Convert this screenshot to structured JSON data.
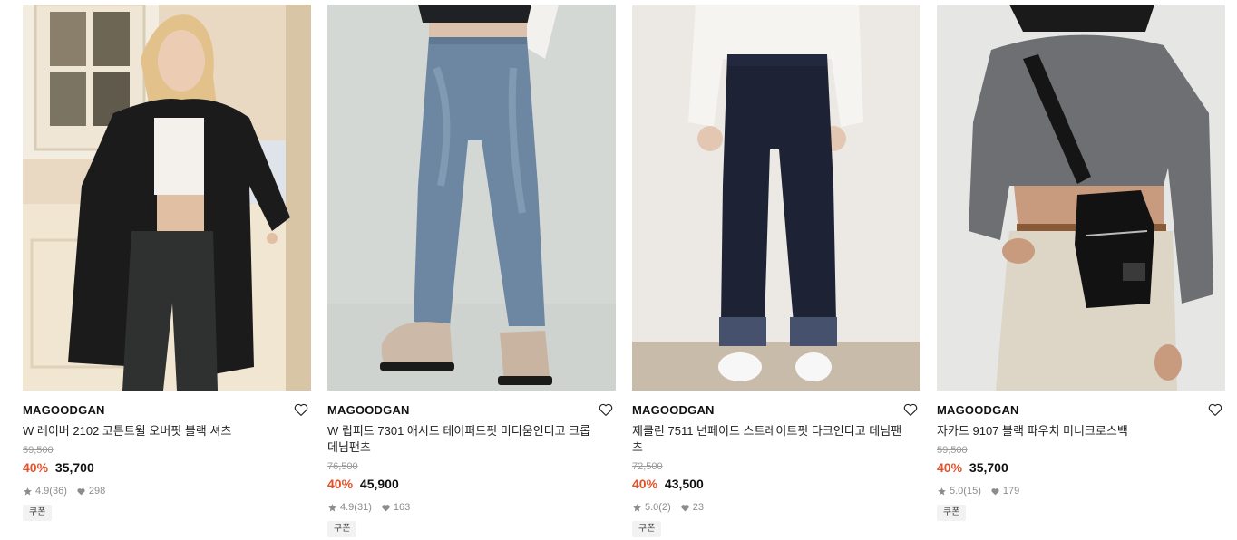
{
  "products": [
    {
      "brand": "MAGOODGAN",
      "name": "W 레이버 2102 코튼트윌 오버핏 블랙 셔츠",
      "original_price": "59,500",
      "discount": "40%",
      "price": "35,700",
      "rating": "4.9",
      "review_count": "(36)",
      "likes": "298",
      "coupon": "쿠폰"
    },
    {
      "brand": "MAGOODGAN",
      "name": "W 립피드 7301 애시드 테이퍼드핏 미디움인디고 크롭 데님팬츠",
      "original_price": "76,500",
      "discount": "40%",
      "price": "45,900",
      "rating": "4.9",
      "review_count": "(31)",
      "likes": "163",
      "coupon": "쿠폰"
    },
    {
      "brand": "MAGOODGAN",
      "name": "제클린 7511 넌페이드 스트레이트핏 다크인디고 데님팬츠",
      "original_price": "72,500",
      "discount": "40%",
      "price": "43,500",
      "rating": "5.0",
      "review_count": "(2)",
      "likes": "23",
      "coupon": "쿠폰"
    },
    {
      "brand": "MAGOODGAN",
      "name": "자카드 9107 블랙 파우치 미니크로스백",
      "original_price": "59,500",
      "discount": "40%",
      "price": "35,700",
      "rating": "5.0",
      "review_count": "(15)",
      "likes": "179",
      "coupon": "쿠폰"
    }
  ],
  "colors": {
    "discount": "#e3522a",
    "original_price": "#9a9a9a",
    "stats": "#8c8c8c",
    "coupon_bg": "#f2f2f2"
  },
  "icons": {
    "wishlist": "heart-outline-icon",
    "rating": "star-icon",
    "likes": "heart-filled-icon"
  }
}
